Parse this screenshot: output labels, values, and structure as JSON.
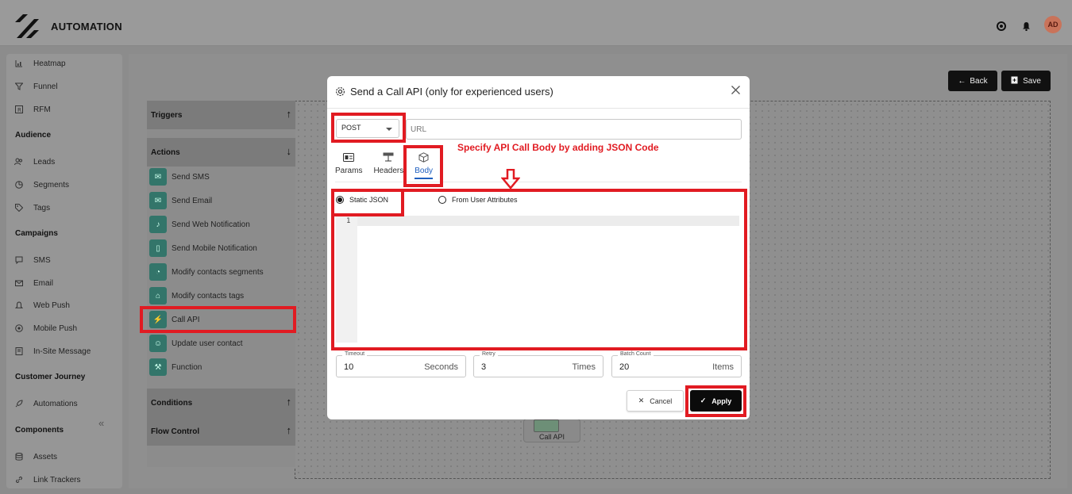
{
  "colors": {
    "highlight": "#e11b22",
    "tab_active": "#1f5fbf",
    "action_icon_bg": "#33756a"
  },
  "app": {
    "brand": "AUTOMATION",
    "avatar_initials": "AD"
  },
  "topbar_icons": [
    "support-icon",
    "bell-icon"
  ],
  "sidebar": {
    "items_top": [
      {
        "label": "Heatmap",
        "icon": "heatmap-icon"
      },
      {
        "label": "Funnel",
        "icon": "funnel-icon"
      },
      {
        "label": "RFM",
        "icon": "rfm-icon"
      }
    ],
    "sections": [
      {
        "title": "Audience",
        "items": [
          {
            "label": "Leads",
            "icon": "leads-icon"
          },
          {
            "label": "Segments",
            "icon": "segments-icon"
          },
          {
            "label": "Tags",
            "icon": "tag-icon"
          }
        ]
      },
      {
        "title": "Campaigns",
        "items": [
          {
            "label": "SMS",
            "icon": "sms-icon"
          },
          {
            "label": "Email",
            "icon": "email-icon"
          },
          {
            "label": "Web Push",
            "icon": "bell-icon"
          },
          {
            "label": "Mobile Push",
            "icon": "mobile-icon"
          },
          {
            "label": "In-Site Message",
            "icon": "message-icon"
          }
        ]
      },
      {
        "title": "Customer Journey",
        "items": [
          {
            "label": "Automations",
            "icon": "rocket-icon"
          }
        ]
      },
      {
        "title": "Components",
        "items": [
          {
            "label": "Assets",
            "icon": "database-icon"
          },
          {
            "label": "Link Trackers",
            "icon": "link-icon"
          }
        ]
      }
    ],
    "collapse_glyph": "«"
  },
  "toolbar": {
    "back_label": "Back",
    "save_label": "Save"
  },
  "panel": {
    "triggers_label": "Triggers",
    "actions_label": "Actions",
    "conditions_label": "Conditions",
    "flow_control_label": "Flow Control",
    "actions": [
      {
        "label": "Send SMS",
        "icon": "sms-icon"
      },
      {
        "label": "Send Email",
        "icon": "email-icon"
      },
      {
        "label": "Send Web Notification",
        "icon": "bell-icon"
      },
      {
        "label": "Send Mobile Notification",
        "icon": "mobile-icon"
      },
      {
        "label": "Modify contacts segments",
        "icon": "pie-icon"
      },
      {
        "label": "Modify contacts tags",
        "icon": "tag-icon"
      },
      {
        "label": "Call API",
        "icon": "plug-icon"
      },
      {
        "label": "Update user contact",
        "icon": "users-icon"
      },
      {
        "label": "Function",
        "icon": "hammer-icon"
      }
    ]
  },
  "canvas_node": {
    "label": "Call API"
  },
  "modal": {
    "title": "Send a Call API (only for experienced users)",
    "method": "POST",
    "url_placeholder": "URL",
    "url_value": "",
    "annotation": "Specify API Call  Body by adding JSON Code",
    "tabs": [
      {
        "label": "Params",
        "icon": "params-icon",
        "active": false
      },
      {
        "label": "Headers",
        "icon": "headers-icon",
        "active": false
      },
      {
        "label": "Body",
        "icon": "cube-icon",
        "active": true
      }
    ],
    "body_mode": {
      "options": [
        "Static JSON",
        "From User Attributes"
      ],
      "selected": "Static JSON"
    },
    "editor": {
      "line_numbers": [
        "1"
      ]
    },
    "timeout": {
      "label": "Timeout",
      "value": "10",
      "unit": "Seconds"
    },
    "retry": {
      "label": "Retry",
      "value": "3",
      "unit": "Times"
    },
    "batch_count": {
      "label": "Batch Count",
      "value": "20",
      "unit": "Items"
    },
    "cancel_label": "Cancel",
    "apply_label": "Apply"
  }
}
